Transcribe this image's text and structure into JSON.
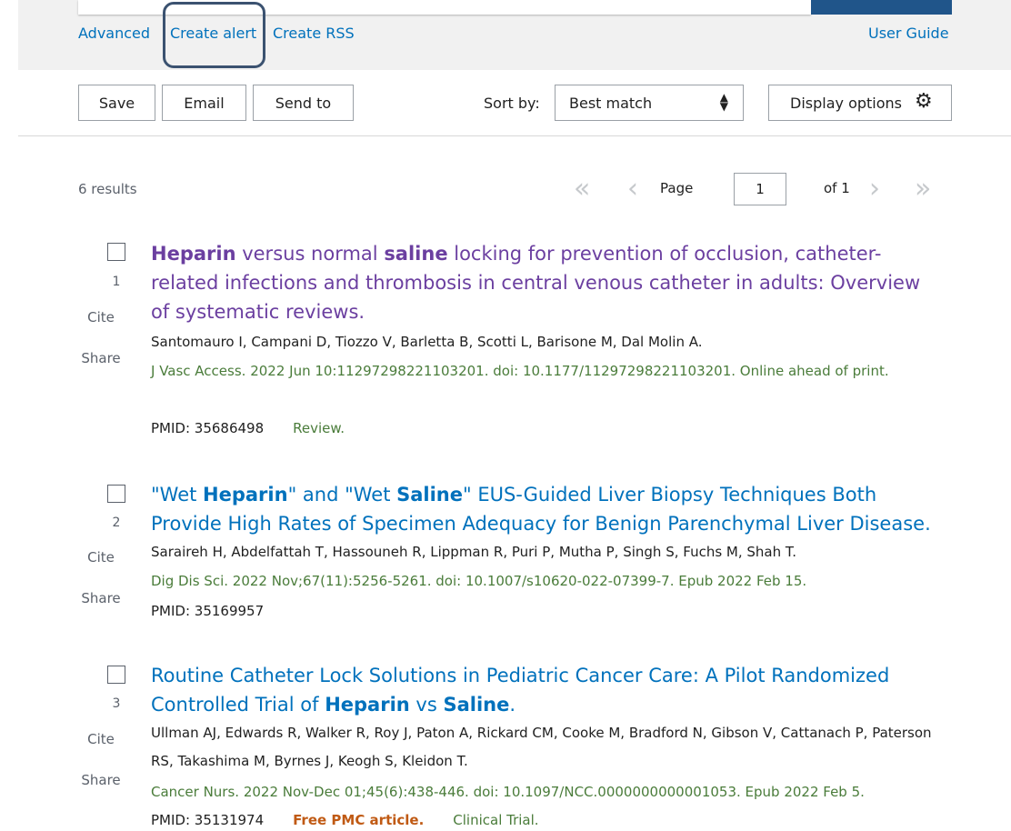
{
  "header_links": {
    "advanced": "Advanced",
    "create_alert": "Create alert",
    "create_rss": "Create RSS",
    "user_guide": "User Guide"
  },
  "actions": {
    "save": "Save",
    "email": "Email",
    "send_to": "Send to",
    "sort_by_label": "Sort by:",
    "sort_value": "Best match",
    "display_options": "Display options"
  },
  "results": {
    "count": "6 results",
    "page_label": "Page",
    "page_value": "1",
    "of_label": "of 1"
  },
  "articles": [
    {
      "number": "1",
      "cite": "Cite",
      "share": "Share",
      "title_html": "<b>Heparin</b> versus normal <b>saline</b> locking for prevention of occlusion, catheter-related infections and thrombosis in central venous catheter in adults: Overview of systematic reviews.",
      "authors": "Santomauro I, Campani D, Tiozzo V, Barletta B, Scotti L, Barisone M, Dal Molin A.",
      "citation": "J Vasc Access. 2022 Jun 10:11297298221103201. doi: 10.1177/11297298221103201. Online ahead of print.",
      "pmid": "PMID: 35686498",
      "free": "",
      "pubtype": "Review."
    },
    {
      "number": "2",
      "cite": "Cite",
      "share": "Share",
      "title_html": "\"Wet <b>Heparin</b>\" and \"Wet <b>Saline</b>\" EUS-Guided Liver Biopsy Techniques Both Provide High Rates of Specimen Adequacy for Benign Parenchymal Liver Disease.",
      "authors": "Saraireh H, Abdelfattah T, Hassouneh R, Lippman R, Puri P, Mutha P, Singh S, Fuchs M, Shah T.",
      "citation": "Dig Dis Sci. 2022 Nov;67(11):5256-5261. doi: 10.1007/s10620-022-07399-7. Epub 2022 Feb 15.",
      "pmid": "PMID: 35169957",
      "free": "",
      "pubtype": ""
    },
    {
      "number": "3",
      "cite": "Cite",
      "share": "Share",
      "title_html": "Routine Catheter Lock Solutions in Pediatric Cancer Care: A Pilot Randomized Controlled Trial of <b>Heparin</b> vs <b>Saline</b>.",
      "authors": "Ullman AJ, Edwards R, Walker R, Roy J, Paton A, Rickard CM, Cooke M, Bradford N, Gibson V, Cattanach P, Paterson RS, Takashima M, Byrnes J, Keogh S, Kleidon T.",
      "citation": "Cancer Nurs. 2022 Nov-Dec 01;45(6):438-446. doi: 10.1097/NCC.0000000000001053. Epub 2022 Feb 5.",
      "pmid": "PMID: 35131974",
      "free": "Free PMC article.",
      "pubtype": "Clinical Trial."
    }
  ],
  "colors": {
    "link": "#0071bc",
    "visited_title": "#6b3fa0",
    "citation": "#4a7c3a",
    "free_pmc": "#c05a14"
  }
}
